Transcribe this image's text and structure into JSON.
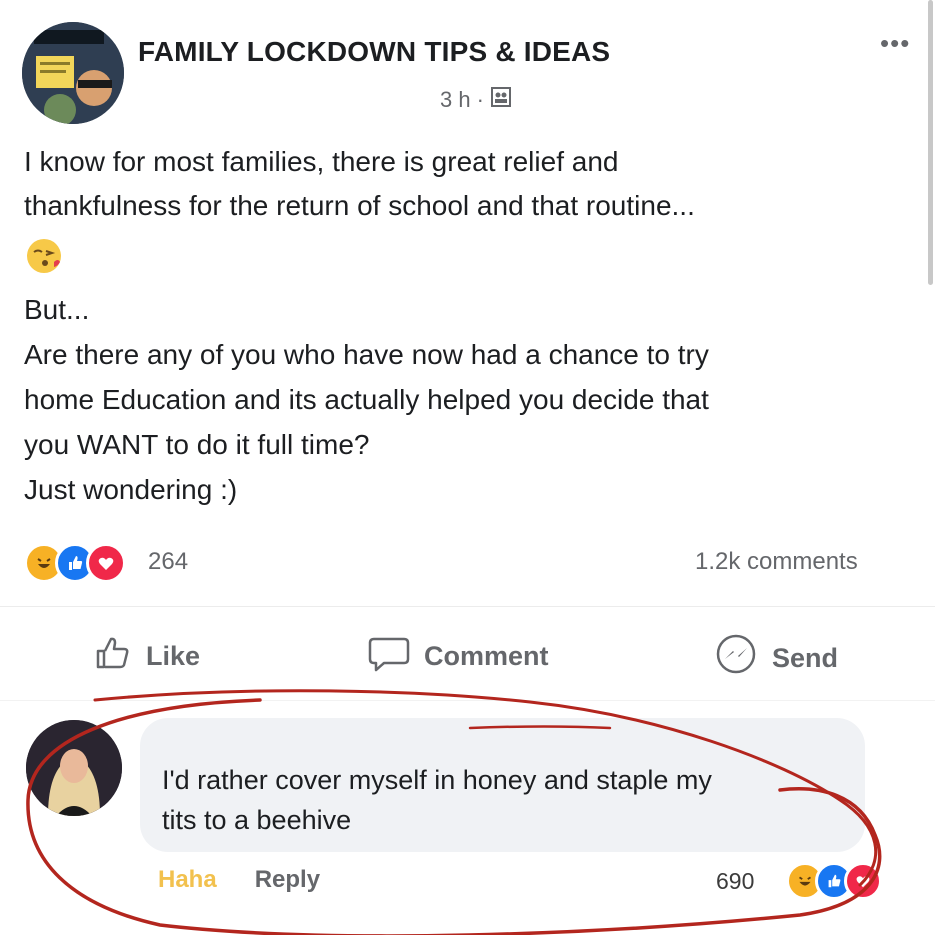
{
  "post": {
    "group_name": "FAMILY LOCKDOWN TIPS & IDEAS",
    "time": "3 h",
    "time_sep": "·",
    "privacy_icon": "group-privacy-icon",
    "more_icon": "more-options-icon",
    "paragraphs": [
      "I know for most families, there is great relief and",
      "thankfulness for the return of school and that routine...",
      "But...",
      "Are there any of you who have now had a chance to try",
      "home Education and its actually helped you decide that",
      "you WANT to do it full time?",
      "Just wondering :)"
    ],
    "emoji": "blowing-kiss-emoji",
    "reaction_count": "264",
    "comment_count": "1.2k comments",
    "reactions": [
      "haha",
      "like",
      "love"
    ]
  },
  "actions": {
    "like": "Like",
    "comment": "Comment",
    "send": "Send"
  },
  "comment": {
    "text_line1": "I'd rather cover myself in honey and staple my",
    "text_line2": "tits to a beehive",
    "haha_label": "Haha",
    "reply_label": "Reply",
    "reaction_count": "690",
    "reactions": [
      "haha",
      "like",
      "love"
    ]
  },
  "colors": {
    "haha_yellow": "#f7b125",
    "like_blue": "#1877f2",
    "love_red": "#f02849",
    "annotation_red": "#b3261e",
    "muted_text": "#65676b"
  }
}
